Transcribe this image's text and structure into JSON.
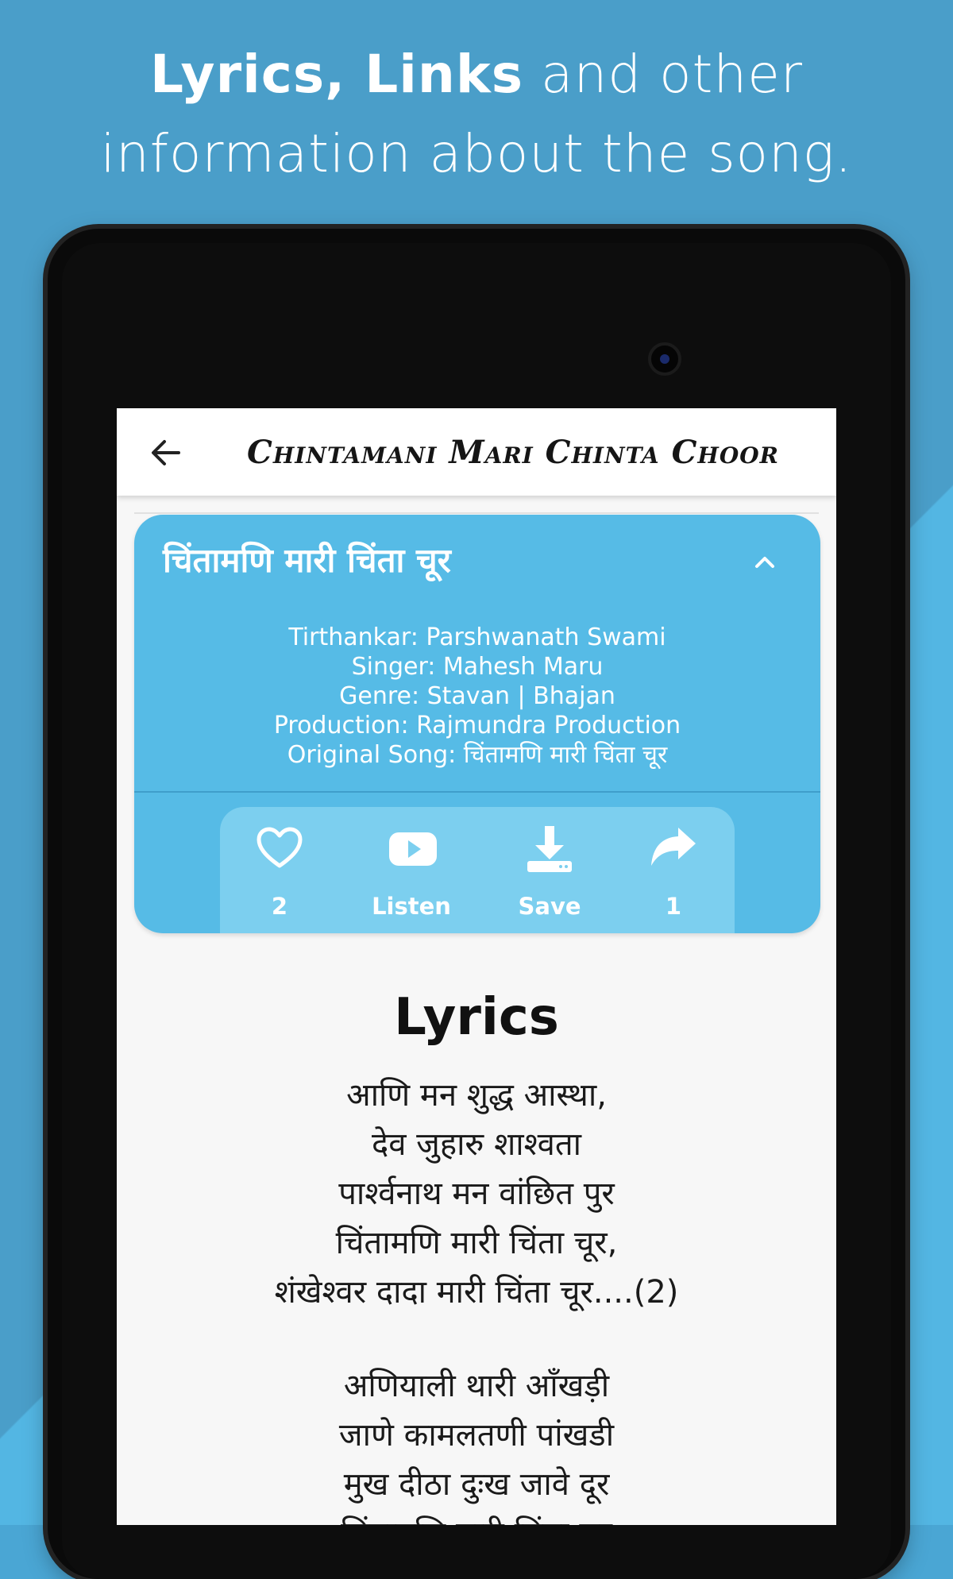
{
  "headline": {
    "line1_bold": "Lyrics, Links",
    "line1_rest": " and other",
    "line2": "information about the song."
  },
  "appbar": {
    "title": "Chintamani Mari Chinta Choor",
    "back_icon": "arrow-left-icon"
  },
  "song_card": {
    "title": "चिंतामणि मारी चिंता चूर",
    "collapse_icon": "chevron-up-icon",
    "info": [
      "Tirthankar: Parshwanath Swami",
      "Singer: Mahesh Maru",
      "Genre: Stavan | Bhajan",
      "Production: Rajmundra Production",
      "Original Song: चिंतामणि मारी चिंता चूर"
    ],
    "actions": [
      {
        "icon": "heart-icon",
        "label": "2"
      },
      {
        "icon": "youtube-play-icon",
        "label": "Listen"
      },
      {
        "icon": "download-icon",
        "label": "Save"
      },
      {
        "icon": "share-icon",
        "label": "1"
      }
    ]
  },
  "lyrics": {
    "heading": "Lyrics",
    "stanzas": [
      [
        "आणि मन शुद्ध आस्था,",
        "देव जुहारु शाश्वता",
        "पार्श्वनाथ मन वांछित पुर",
        "चिंतामणि मारी चिंता चूर,",
        "शंखेश्वर दादा मारी चिंता चूर....(2)"
      ],
      [
        "अणियाली थारी आँखड़ी",
        "जाणे कामलतणी पांखडी",
        "मुख दीठा दुःख जावे दूर",
        "चिंतामणि मारी चिंता चूर"
      ]
    ]
  },
  "colors": {
    "background": "#4aa6d4",
    "card": "#56bbe6",
    "actions_panel": "#7ccfef",
    "text_dark": "#111111"
  }
}
